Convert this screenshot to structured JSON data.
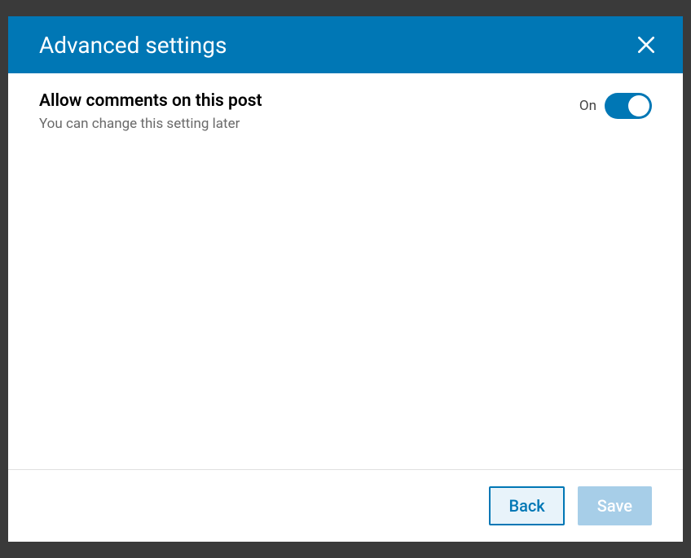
{
  "header": {
    "title": "Advanced settings"
  },
  "settings": {
    "allowComments": {
      "title": "Allow comments on this post",
      "subtitle": "You can change this setting later",
      "stateLabel": "On",
      "value": true
    }
  },
  "footer": {
    "backLabel": "Back",
    "saveLabel": "Save"
  }
}
